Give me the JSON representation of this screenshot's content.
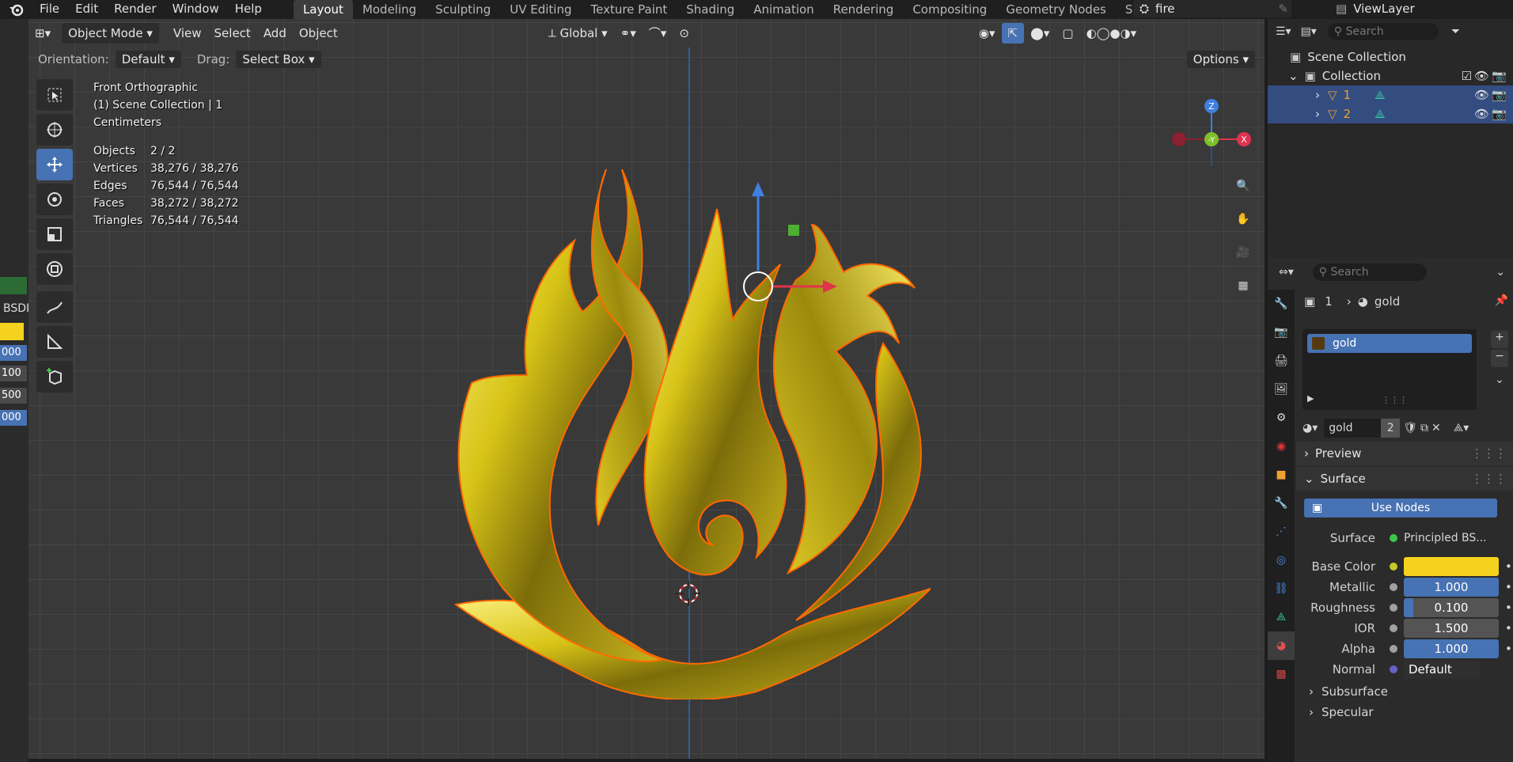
{
  "topbar": {
    "menus": [
      "File",
      "Edit",
      "Render",
      "Window",
      "Help"
    ],
    "workspaces": [
      "Layout",
      "Modeling",
      "Sculpting",
      "UV Editing",
      "Texture Paint",
      "Shading",
      "Animation",
      "Rendering",
      "Compositing",
      "Geometry Nodes",
      "Scripting"
    ],
    "active_workspace": "Layout",
    "scene_name": "fire",
    "view_layer": "ViewLayer"
  },
  "left_strip": {
    "label": "BSDI",
    "values": [
      "000",
      "100",
      "500",
      "000"
    ]
  },
  "viewport": {
    "header": {
      "mode": "Object Mode",
      "menus": [
        "View",
        "Select",
        "Add",
        "Object"
      ],
      "transform_orientation": "Global"
    },
    "tool_settings": {
      "orientation_label": "Orientation:",
      "orientation_value": "Default",
      "drag_label": "Drag:",
      "drag_value": "Select Box",
      "options_label": "Options"
    },
    "overlay": {
      "view_name": "Front Orthographic",
      "collection_line": "(1) Scene Collection | 1",
      "units": "Centimeters",
      "stats": [
        {
          "label": "Objects",
          "value": "2 / 2"
        },
        {
          "label": "Vertices",
          "value": "38,276 / 38,276"
        },
        {
          "label": "Edges",
          "value": "76,544 / 76,544"
        },
        {
          "label": "Faces",
          "value": "38,272 / 38,272"
        },
        {
          "label": "Triangles",
          "value": "76,544 / 76,544"
        }
      ]
    },
    "gizmo_axes": {
      "z": "Z",
      "y": "-Y",
      "x": "X"
    }
  },
  "outliner": {
    "search_placeholder": "Search",
    "scene_collection": "Scene Collection",
    "collection": "Collection",
    "objects": [
      "1",
      "2"
    ]
  },
  "properties": {
    "search_placeholder": "Search",
    "breadcrumb_object": "1",
    "breadcrumb_material": "gold",
    "material_slot": "gold",
    "material_name": "gold",
    "user_count": "2",
    "panels": {
      "preview": "Preview",
      "surface": "Surface",
      "subsurface": "Subsurface",
      "specular": "Specular"
    },
    "use_nodes": "Use Nodes",
    "fields": {
      "surface_label": "Surface",
      "surface_value": "Principled BS...",
      "base_color_label": "Base Color",
      "base_color": "#f5d21e",
      "metallic_label": "Metallic",
      "metallic": "1.000",
      "roughness_label": "Roughness",
      "roughness": "0.100",
      "ior_label": "IOR",
      "ior": "1.500",
      "alpha_label": "Alpha",
      "alpha": "1.000",
      "normal_label": "Normal",
      "normal": "Default"
    }
  },
  "colors": {
    "accent": "#4772b3",
    "selected_row": "#334d80",
    "gold": "#c9b31a"
  }
}
